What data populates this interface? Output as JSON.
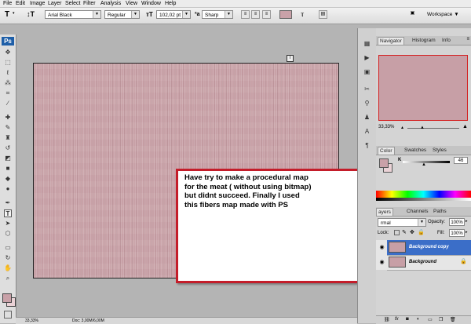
{
  "menu": [
    "File",
    "Edit",
    "Image",
    "Layer",
    "Select",
    "Filter",
    "Analysis",
    "View",
    "Window",
    "Help"
  ],
  "options": {
    "tool_glyph": "T",
    "font_family": "Arial Black",
    "font_style": "Regular",
    "font_size": "102,02 pt",
    "antialias": "Sharp",
    "text_color": "#c9a1a8",
    "workspace_label": "Workspace"
  },
  "toolbox": {
    "logo": "Ps",
    "fg_color": "#c9a1a8",
    "bg_color": "#ead2d6"
  },
  "canvas": {
    "texture_color": "#c8a1a7"
  },
  "note": {
    "lines": [
      "Have try to make a procedural map",
      "for the meat ( without using bitmap)",
      "but didnt succeed.  Finally I used",
      "this fibers map made with PS"
    ],
    "border_color": "#c41d2a"
  },
  "panels": {
    "navigator": {
      "tabs": [
        "Navigator",
        "Histogram",
        "Info"
      ],
      "zoom": "33,33%"
    },
    "color": {
      "tabs": [
        "Color",
        "Swatches",
        "Styles"
      ],
      "channel": "K",
      "value": "46"
    },
    "layers": {
      "tabs": [
        "ayers",
        "Channels",
        "Paths"
      ],
      "blend_mode": "rmal",
      "opacity_label": "Opacity:",
      "opacity": "100%",
      "lock_label": "Lock:",
      "fill_label": "Fill:",
      "fill": "100%",
      "layers": [
        {
          "name": "Background copy",
          "selected": true
        },
        {
          "name": "Background",
          "selected": false
        }
      ]
    }
  },
  "status": {
    "zoom": "33,33%",
    "doc": "Doc: 3,00M/6,00M"
  }
}
